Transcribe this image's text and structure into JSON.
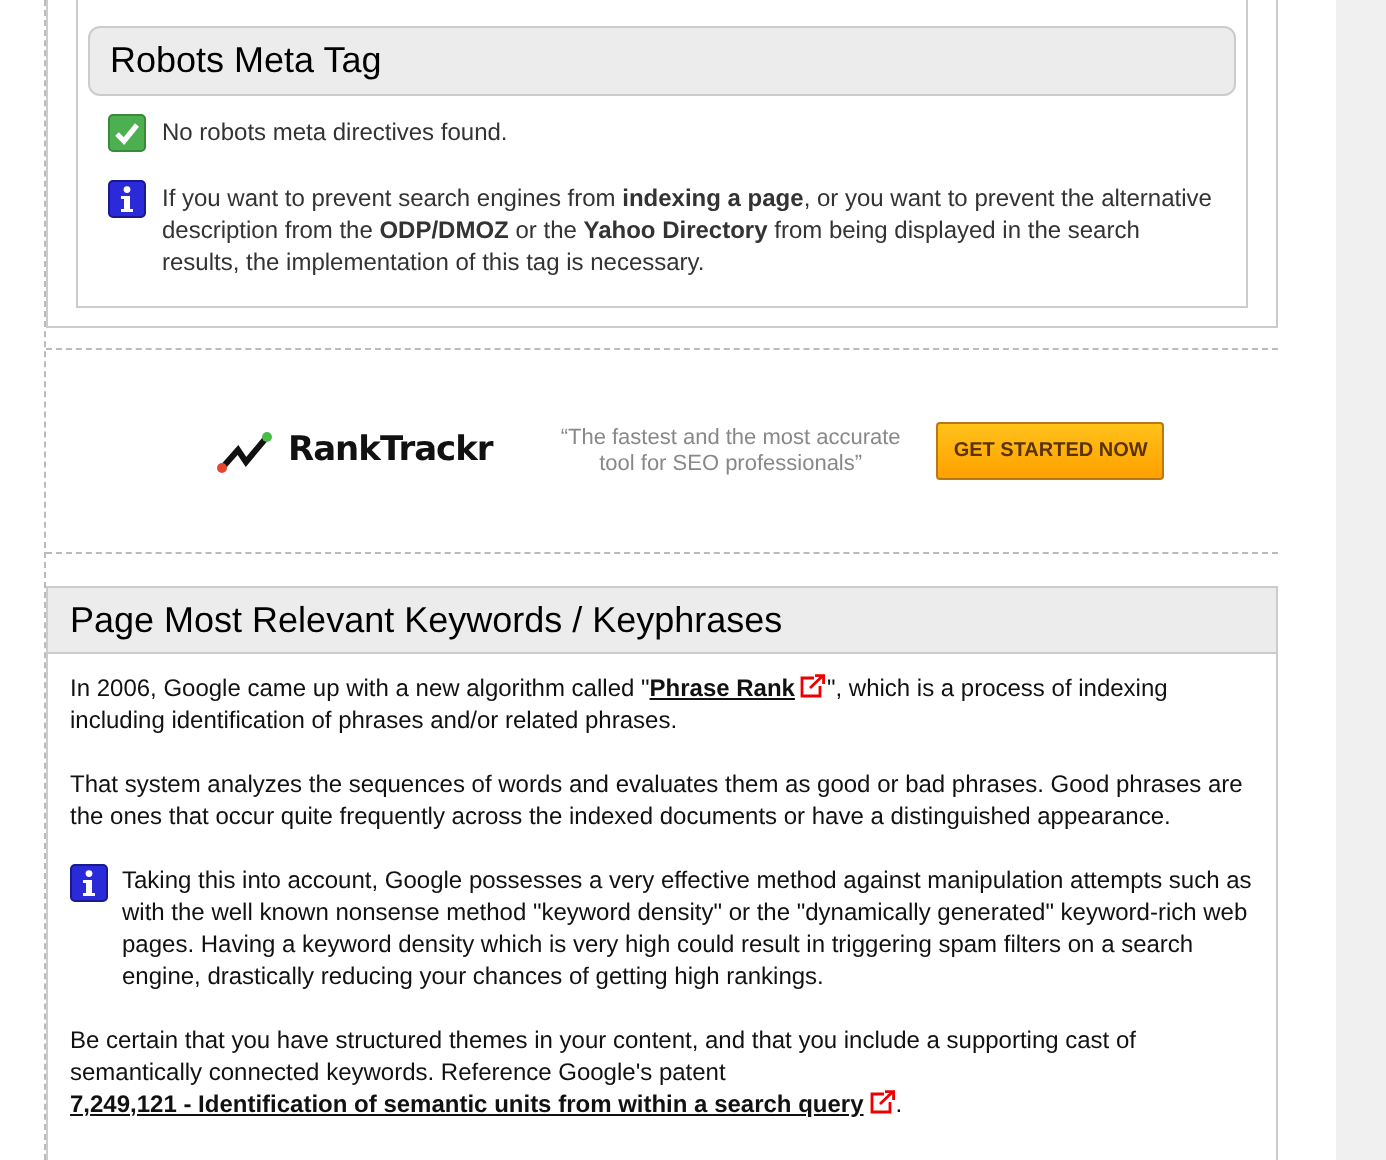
{
  "robots_section": {
    "title": "Robots Meta Tag",
    "messages": [
      {
        "kind": "success",
        "text": "No robots meta directives found."
      },
      {
        "kind": "info",
        "text": "If you want to prevent search engines from **indexing a page**, or you want to prevent the alternative description from the **ODP/DMOZ** or the **Yahoo Directory** from being displayed in the search results, the implementation of this tag is necessary."
      }
    ]
  },
  "ad_banner": {
    "brand": "RankTrackr",
    "quote": "“The fastest and the most accurate tool for SEO professionals”",
    "button": "GET STARTED NOW"
  },
  "keywords_section": {
    "title": "Page Most Relevant Keywords / Keyphrases",
    "paragraphs": [
      {
        "kind": "text",
        "before": "In 2006, Google came up with a new algorithm called \"",
        "link": "Phrase Rank",
        "after": "\", which is a process of indexing including identification of phrases and/or related phrases."
      },
      {
        "kind": "text",
        "before": "That system analyzes the sequences of words and evaluates them as good or bad phrases. Good phrases are the ones that occur quite frequently across the indexed documents or have a distinguished appearance."
      },
      {
        "kind": "info",
        "before": "Taking this into account, Google possesses a very effective method against manipulation attempts such as with the well known nonsense method \"keyword density\" or the \"dynamically generated\" keyword-rich web pages. Having a keyword density which is very high could result in triggering spam filters on a search engine, drastically reducing your chances of getting high rankings."
      },
      {
        "kind": "text",
        "before": "Be certain that you have structured themes in your content, and that you include a supporting cast of semantically connected keywords. Reference Google's patent ",
        "link": "7,249,121 - Identification of semantic units from within a search query",
        "after": "."
      }
    ]
  }
}
